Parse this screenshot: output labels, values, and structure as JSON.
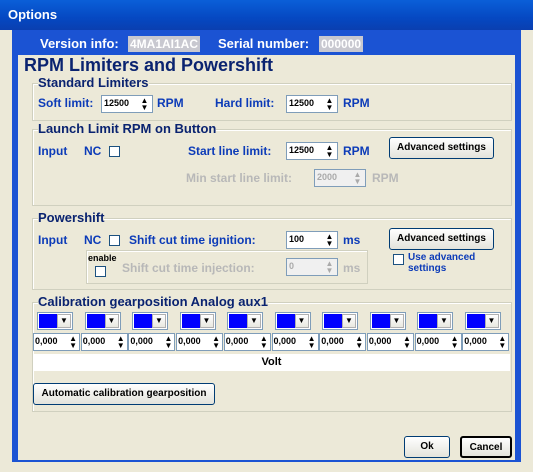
{
  "window": {
    "title": "Options"
  },
  "header": {
    "version_label": "Version info:",
    "version_value": "4MA1AI1AC",
    "serial_label": "Serial number:",
    "serial_value": "000000"
  },
  "main_title": "RPM Limiters and Powershift",
  "standard": {
    "title": "Standard Limiters",
    "soft_label": "Soft limit:",
    "soft_value": "12500",
    "hard_label": "Hard limit:",
    "hard_value": "12500",
    "unit": "RPM"
  },
  "launch": {
    "title": "Launch Limit RPM on Button",
    "input_label": "Input",
    "nc_label": "NC",
    "start_label": "Start line limit:",
    "start_value": "12500",
    "unit": "RPM",
    "adv_button": "Advanced settings",
    "min_label": "Min start line limit:",
    "min_value": "2000"
  },
  "powershift": {
    "title": "Powershift",
    "input_label": "Input",
    "nc_label": "NC",
    "ign_label": "Shift cut time ignition:",
    "ign_value": "100",
    "inj_label": "Shift cut time injection:",
    "inj_value": "0",
    "unit": "ms",
    "enable_label": "enable",
    "adv_button": "Advanced settings",
    "use_adv_label": "Use advanced settings"
  },
  "calibration": {
    "title": "Calibration gearposition Analog aux1",
    "values": [
      "0,000",
      "0,000",
      "0,000",
      "0,000",
      "0,000",
      "0,000",
      "0,000",
      "0,000",
      "0,000",
      "0,000"
    ],
    "volt_label": "Volt",
    "auto_button": "Automatic calibration gearposition"
  },
  "footer": {
    "ok_label": "Ok",
    "cancel_label": "Cancel"
  },
  "colors": {
    "swatch": "#0000ff",
    "accent": "#1b53d3"
  }
}
